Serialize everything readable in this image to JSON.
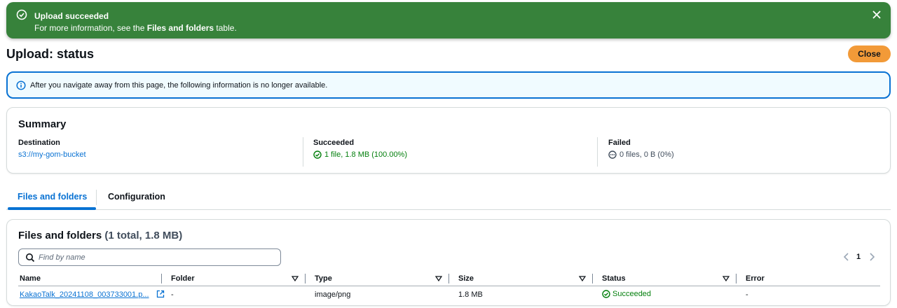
{
  "flash": {
    "title": "Upload succeeded",
    "message_prefix": "For more information, see the ",
    "message_bold": "Files and folders",
    "message_suffix": " table."
  },
  "header": {
    "title": "Upload: status",
    "close_label": "Close"
  },
  "info": {
    "text": "After you navigate away from this page, the following information is no longer available."
  },
  "summary": {
    "title": "Summary",
    "destination_label": "Destination",
    "destination_value": "s3://my-gom-bucket",
    "succeeded_label": "Succeeded",
    "succeeded_value": "1 file, 1.8 MB (100.00%)",
    "failed_label": "Failed",
    "failed_value": "0 files, 0 B (0%)"
  },
  "tabs": [
    {
      "label": "Files and folders",
      "active": true
    },
    {
      "label": "Configuration",
      "active": false
    }
  ],
  "files": {
    "title": "Files and folders",
    "count": "(1 total, 1.8 MB)",
    "search_placeholder": "Find by name",
    "page": "1",
    "columns": [
      "Name",
      "Folder",
      "Type",
      "Size",
      "Status",
      "Error"
    ],
    "rows": [
      {
        "name": "KakaoTalk_20241108_003733001.p...",
        "folder": "-",
        "type": "image/png",
        "size": "1.8 MB",
        "status": "Succeeded",
        "error": "-"
      }
    ]
  },
  "colors": {
    "success": "#37823b",
    "accent": "#0972d3",
    "primary_button": "#f29a38",
    "success_text": "#037f0c"
  }
}
